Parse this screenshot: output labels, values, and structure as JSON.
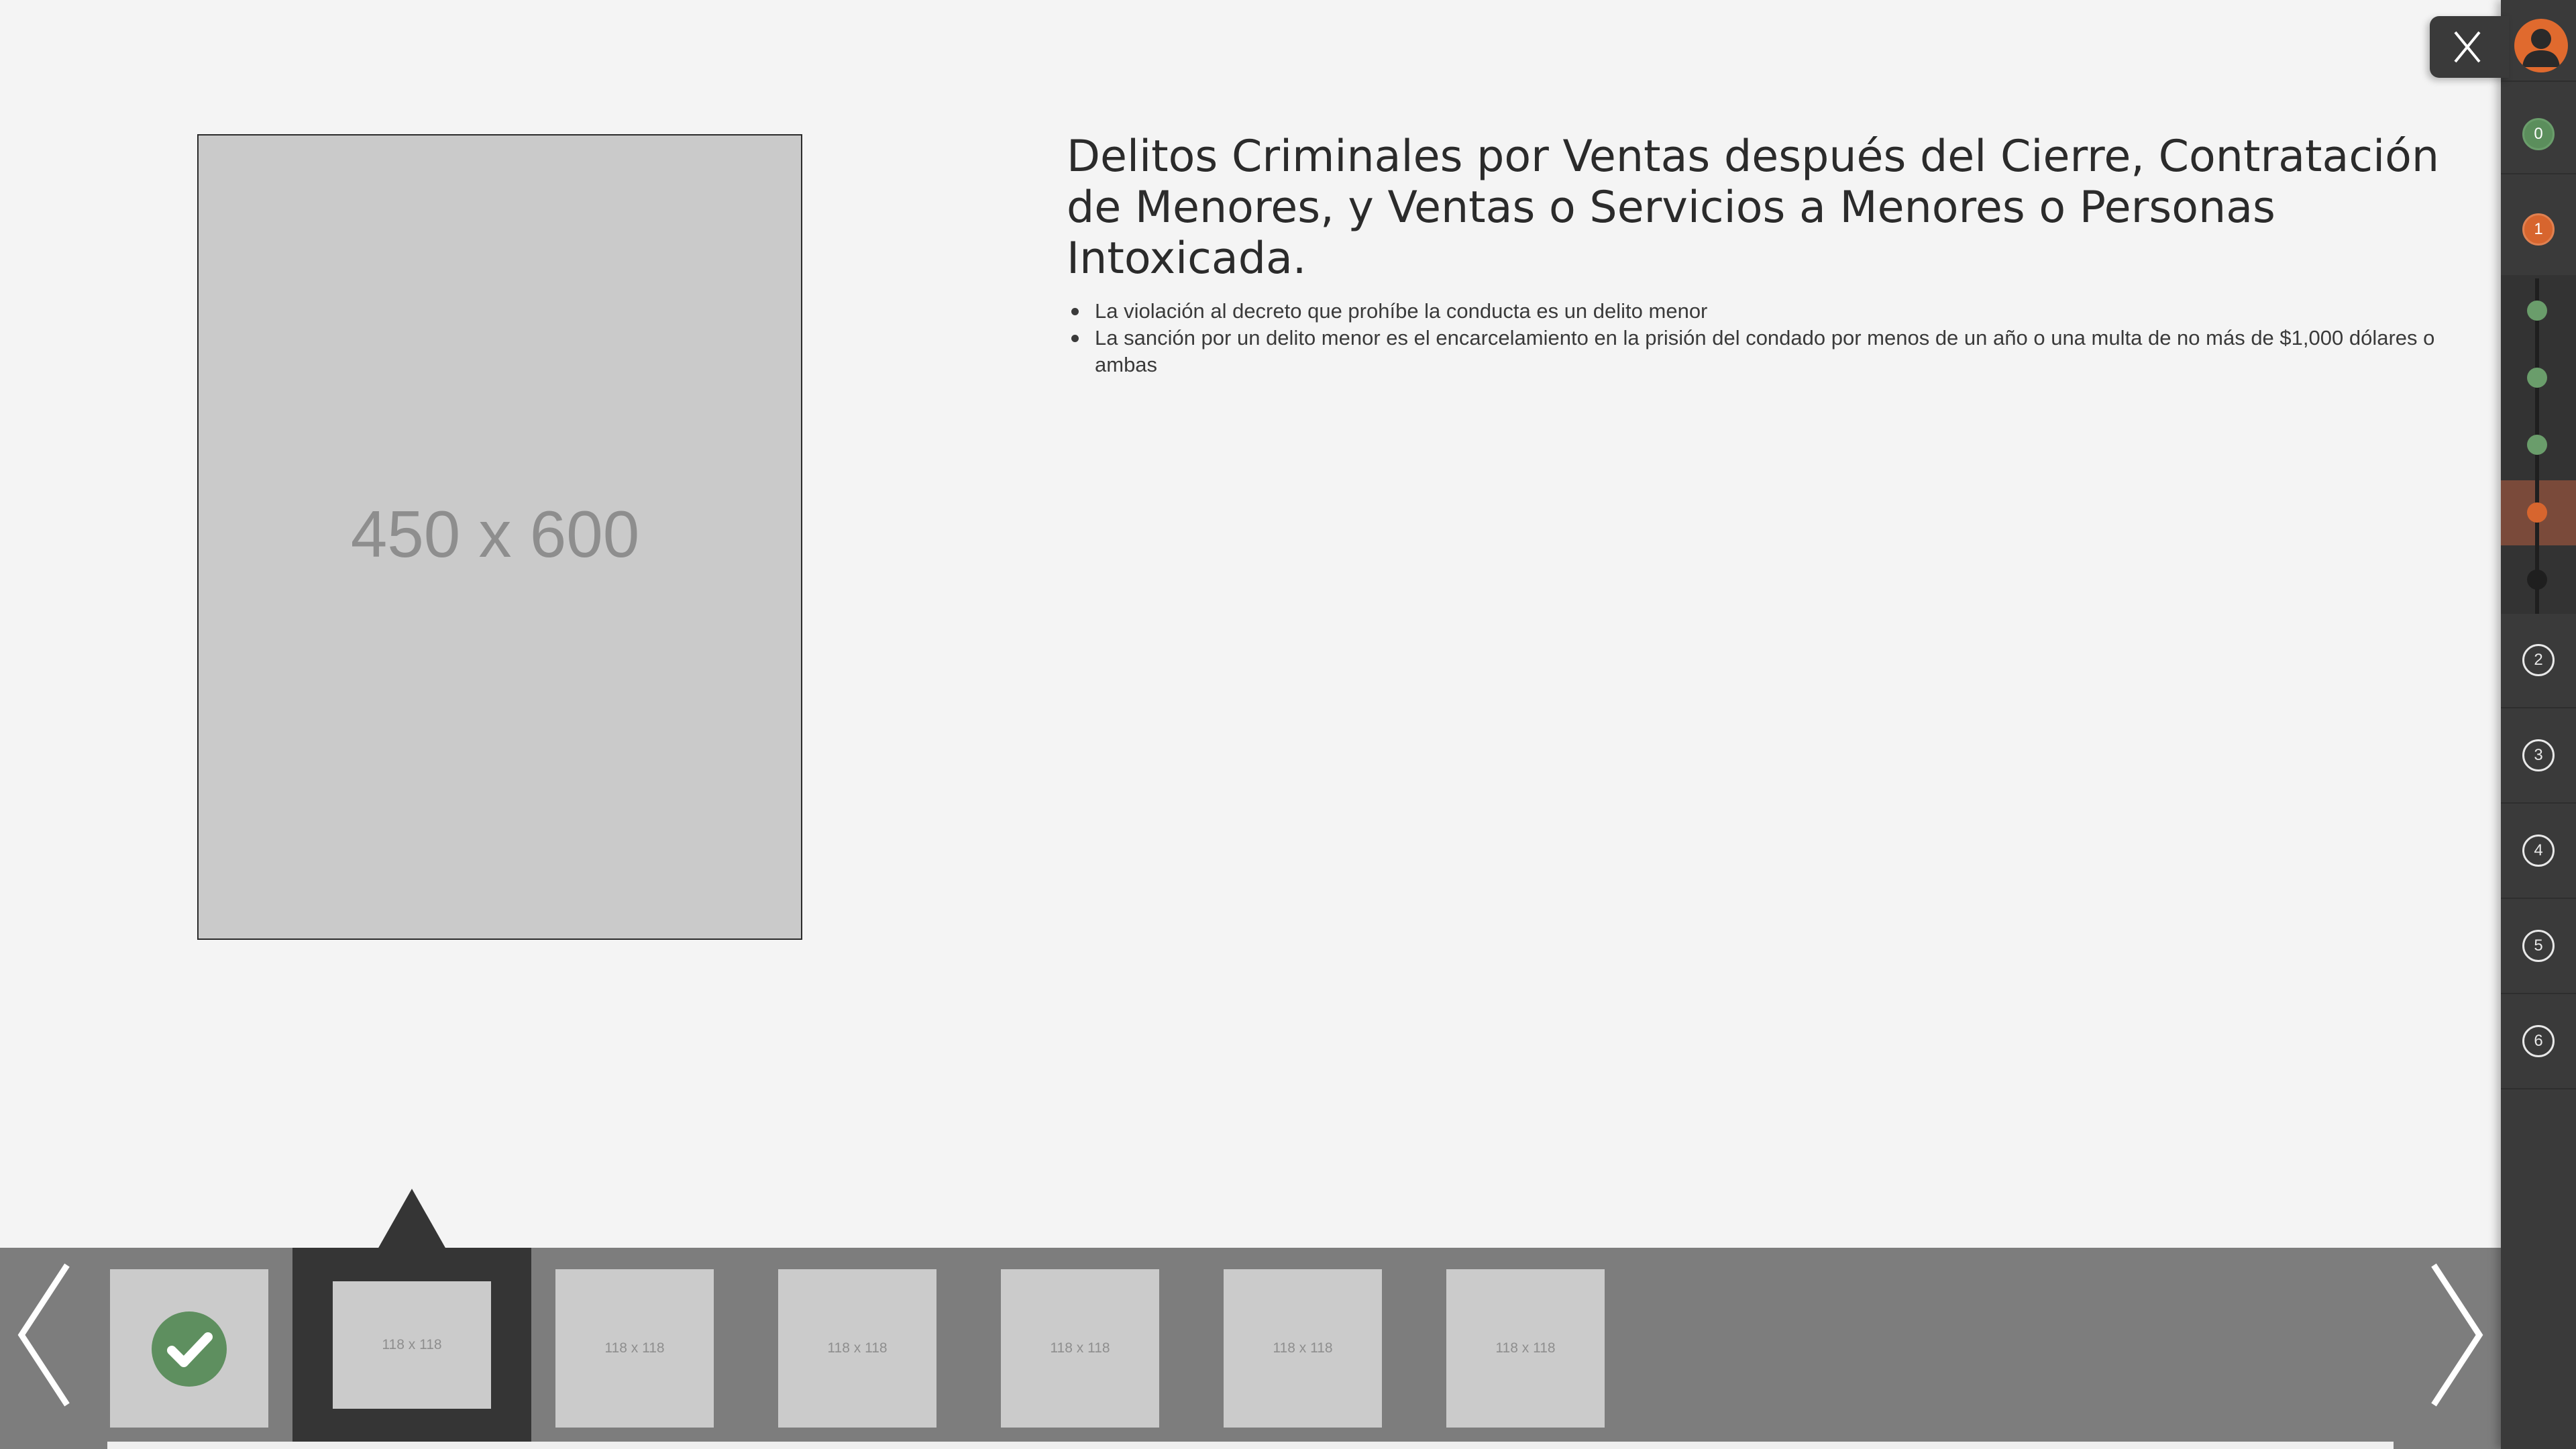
{
  "main_image": {
    "placeholder": "450 x 600"
  },
  "content": {
    "title": "Delitos Criminales por Ventas después del Cierre, Contratación de Menores, y Ventas o Servicios a Menores o Personas Intoxicada.",
    "bullets": [
      "La violación al decreto que prohíbe la conducta es un delito menor",
      "La sanción por un delito menor es el encarcelamiento en la prisión del condado por menos de un año o una multa de no más de $1,000 dólares o ambas"
    ]
  },
  "close_button": {
    "label": "X"
  },
  "sidebar": {
    "steps": [
      "0",
      "1",
      "2",
      "3",
      "4",
      "5",
      "6"
    ],
    "current_step": "1",
    "colors": {
      "done": "#5b8e5c",
      "current": "#d7652e",
      "pending": "#1f1f1f"
    }
  },
  "filmstrip": {
    "thumb_label": "118 x 118",
    "active_index": 1,
    "completed_index": 0
  },
  "icons": [
    "chevron-left-icon",
    "chevron-right-icon",
    "close-icon",
    "user-icon",
    "checkmark-icon"
  ]
}
